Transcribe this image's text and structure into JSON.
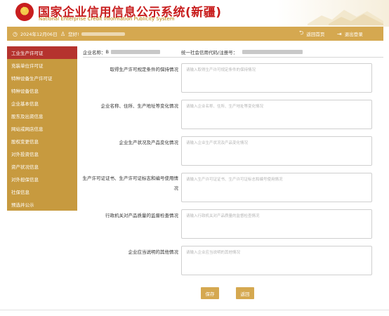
{
  "header": {
    "title_cn": "国家企业信用信息公示系统(新疆)",
    "title_en": "National Enterprise Credit Information Publicity System"
  },
  "topbar": {
    "date": "2024年12月06日",
    "user_prefix": "您好!",
    "home_link": "返回首页",
    "logout_link": "退出登录"
  },
  "sidebar": {
    "items": [
      {
        "label": "工业生产许可证"
      },
      {
        "label": "充装单位许可证"
      },
      {
        "label": "特种设备生产许可证"
      },
      {
        "label": "特种设备信息"
      },
      {
        "label": "企业基本信息"
      },
      {
        "label": "股东及出资信息"
      },
      {
        "label": "网站或网店信息"
      },
      {
        "label": "股权变更信息"
      },
      {
        "label": "对外投资信息"
      },
      {
        "label": "资产状况信息"
      },
      {
        "label": "对外担保信息"
      },
      {
        "label": "社保信息"
      },
      {
        "label": "预选并公示"
      }
    ],
    "active_index": 0
  },
  "info": {
    "company_label": "企业名称：",
    "company_value_prefix": "B",
    "credit_code_label": "统一社会信用代码/注册号："
  },
  "form": {
    "fields": [
      {
        "label": "取得生产许可规定条件的保持情况",
        "placeholder": "请输入取得生产许可规定条件的保持情况"
      },
      {
        "label": "企业名称、住所、生产地址等变化情况",
        "placeholder": "请输入企业名称、住所、生产地址等变化情况"
      },
      {
        "label": "企业生产状况及产品变化情况",
        "placeholder": "请输入企业生产状况及产品变化情况"
      },
      {
        "label": "生产许可证证书、生产许可证标志和编号使用情况",
        "placeholder": "请输入生产许可证证书、生产许可证标志和编号使用情况"
      },
      {
        "label": "行政机关对产品质量的监督检查情况",
        "placeholder": "请输入行政机关对产品质量的监督检查情况"
      },
      {
        "label": "企业应当说明的其他情况",
        "placeholder": "请输入企业应当说明的其他情况"
      }
    ],
    "save_label": "保存",
    "back_label": "返回"
  },
  "colors": {
    "primary_gold": "#d5a850",
    "sidebar_gold": "#c79a3f",
    "active_red": "#b5332e",
    "title_red": "#c81e1e"
  }
}
